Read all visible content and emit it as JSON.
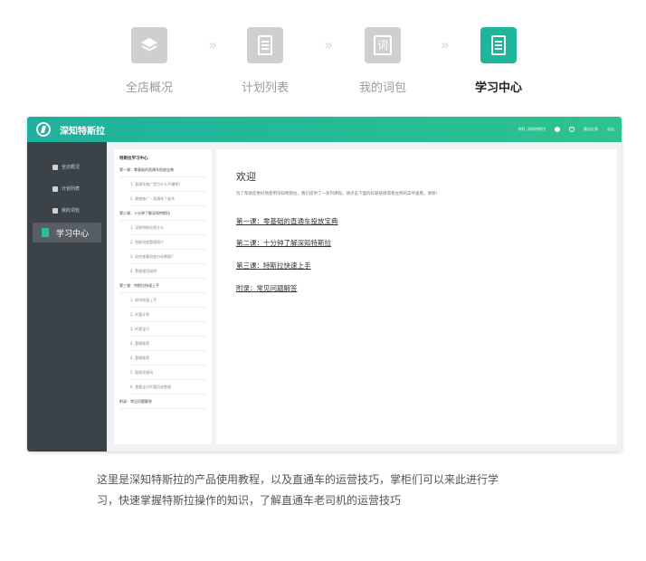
{
  "steps": [
    {
      "label": "全店概况",
      "icon": "layers-icon"
    },
    {
      "label": "计划列表",
      "icon": "document-icon"
    },
    {
      "label": "我的词包",
      "icon": "word-pack-icon",
      "glyph": "词"
    },
    {
      "label": "学习中心",
      "icon": "book-icon"
    }
  ],
  "step_separator": "»",
  "app": {
    "brand": "深知特斯拉",
    "topbar": {
      "user_text": "你好, 深知特斯拉",
      "help_label": "建议反馈",
      "logout_label": "退出"
    },
    "sidebar": {
      "items": [
        {
          "label": "全店概况",
          "icon": "layers-icon"
        },
        {
          "label": "计划列表",
          "icon": "list-icon"
        },
        {
          "label": "我的词包",
          "icon": "word-pack-icon"
        }
      ],
      "active": {
        "label": "学习中心",
        "icon": "book-icon"
      }
    },
    "toc": {
      "title": "特斯拉学习中心",
      "rows": [
        {
          "text": "第一课：零基础的直通车投放宝典",
          "level": 0
        },
        {
          "text": "1. 直通车推广是为什么不赚钱?",
          "level": 1
        },
        {
          "text": "2. 建推推广 - 直通车三板斧",
          "level": 1
        },
        {
          "text": "第二课：十分钟了解深知特斯拉",
          "level": 0
        },
        {
          "text": "1. 深知特斯拉是什么",
          "level": 1
        },
        {
          "text": "2. 智能投放管理简介",
          "level": 1
        },
        {
          "text": "3. 如何查看投放分析数据?",
          "level": 1
        },
        {
          "text": "4. 警报使用说明",
          "level": 1
        },
        {
          "text": "第三课：特斯拉快速上手",
          "level": 0
        },
        {
          "text": "1. 如何快速上手",
          "level": 1
        },
        {
          "text": "2. 托管计划",
          "level": 1
        },
        {
          "text": "3. 托管宝贝",
          "level": 1
        },
        {
          "text": "4. 管理推荐",
          "level": 1
        },
        {
          "text": "4. 管理推荐",
          "level": 1
        },
        {
          "text": "5. 管理关键词",
          "level": 1
        },
        {
          "text": "6. 查看宝贝托管历史数据",
          "level": 1
        },
        {
          "text": "附录：常见问题解答",
          "level": 0
        }
      ]
    },
    "content": {
      "title": "欢迎",
      "description": "为了帮助您更好地使用深知特斯拉，我们提供了一系列课程。请点击下面的标题链接或者左侧的菜单查看。谢谢!",
      "links": [
        "第一课：零基础的直通车投放宝典",
        "第二课：十分钟了解深知特斯拉",
        "第三课：特斯拉快速上手",
        "附录：常见问题解答"
      ]
    }
  },
  "caption": [
    "这里是深知特斯拉的产品使用教程，以及直通车的运营技巧，掌柜们可以来此进行学",
    "习，快速掌握特斯拉操作的知识，了解直通车老司机的运营技巧"
  ],
  "colors": {
    "accent": "#1fb59a",
    "sidebar": "#3c4348",
    "inactive_tile": "#cfcfcf"
  }
}
